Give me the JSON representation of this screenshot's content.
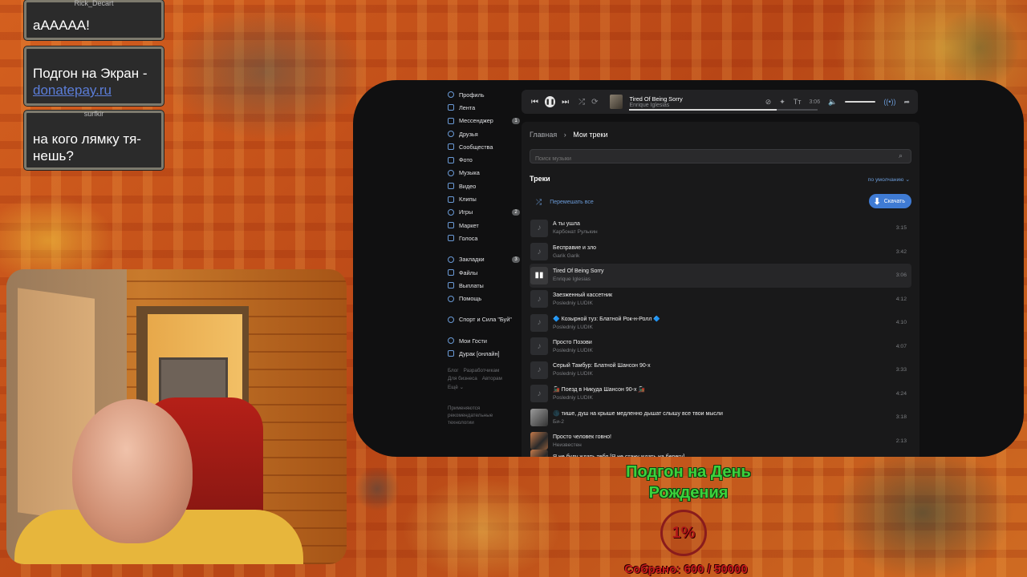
{
  "chat": [
    {
      "nick": "Rick_Decart",
      "text": "аААААА!"
    },
    {
      "nick": "",
      "text": "Подгон на Экран - ",
      "link": "donatepay.ru"
    },
    {
      "nick": "surfkir",
      "text": "на кого лямку тя-нешь?"
    }
  ],
  "sidebar": {
    "items": [
      {
        "label": "Профиль",
        "icon": "user-icon"
      },
      {
        "label": "Лента",
        "icon": "feed-icon"
      },
      {
        "label": "Мессенджер",
        "icon": "chat-icon",
        "badge": "1"
      },
      {
        "label": "Друзья",
        "icon": "friends-icon"
      },
      {
        "label": "Сообщества",
        "icon": "groups-icon"
      },
      {
        "label": "Фото",
        "icon": "photo-icon"
      },
      {
        "label": "Музыка",
        "icon": "music-icon"
      },
      {
        "label": "Видео",
        "icon": "video-icon"
      },
      {
        "label": "Клипы",
        "icon": "clips-icon"
      },
      {
        "label": "Игры",
        "icon": "games-icon",
        "badge": "2"
      },
      {
        "label": "Маркет",
        "icon": "market-icon"
      },
      {
        "label": "Голоса",
        "icon": "votes-icon"
      }
    ],
    "items2": [
      {
        "label": "Закладки",
        "icon": "bookmark-icon",
        "badge": "3"
      },
      {
        "label": "Файлы",
        "icon": "files-icon"
      },
      {
        "label": "Выплаты",
        "icon": "payments-icon"
      },
      {
        "label": "Помощь",
        "icon": "help-icon"
      }
    ],
    "items3": [
      {
        "label": "Спорт и Сила \"Буй\"",
        "icon": "community-icon"
      }
    ],
    "items4": [
      {
        "label": "Мои Гости",
        "icon": "guests-icon"
      },
      {
        "label": "Дурак [онлайн]",
        "icon": "app-icon"
      }
    ],
    "footer_links": [
      "Блог",
      "Разработчикам",
      "Для бизнеса",
      "Авторам",
      "Ещё ⌄"
    ],
    "footer_note": "Применяются рекомендательные технологии"
  },
  "player": {
    "title": "Tired Of Being Sorry",
    "artist": "Enrique Iglesias",
    "time": "3:06",
    "progress": 0.78
  },
  "content": {
    "breadcrumb_home": "Главная",
    "breadcrumb_sep": "›",
    "breadcrumb_current": "Мои треки",
    "search_placeholder": "Поиск музыки",
    "section_title": "Треки",
    "sort_label": "по умолчанию ⌄",
    "shuffle_label": "Перемешать все",
    "download_label": "Скачать",
    "tracks": [
      {
        "title": "А ты ушла",
        "artist": "Карбонат Рулькин",
        "duration": "3:15"
      },
      {
        "title": "Бесправие и зло",
        "artist": "Garik Garik",
        "duration": "3:42"
      },
      {
        "title": "Tired Of Being Sorry",
        "artist": "Enrique Iglesias",
        "duration": "3:06",
        "active": true
      },
      {
        "title": "Заезженный кассетник",
        "artist": "Posledniy LUDIK",
        "duration": "4:12"
      },
      {
        "title": "🔷 Козырной туз: Блатной Рок-н-Ролл 🔷",
        "artist": "Posledniy LUDIK",
        "duration": "4:10"
      },
      {
        "title": "Просто Позови",
        "artist": "Posledniy LUDIK",
        "duration": "4:07"
      },
      {
        "title": "Серый Тамбур: Блатной Шансон 90-х",
        "artist": "Posledniy LUDIK",
        "duration": "3:33"
      },
      {
        "title": "🚂 Поезд в Никуда Шансон 90-х 🚂",
        "artist": "Posledniy LUDIK",
        "duration": "4:24"
      },
      {
        "title": "🌑 тише, душ на крыше медленно дышат слышу все твои мысли",
        "artist": "Би-2",
        "duration": "3:18"
      },
      {
        "title": "Просто человек говно!",
        "artist": "Неизвестен",
        "duration": "2:13"
      },
      {
        "title": "Я не буду ждать тебя [Я не стану ждать на берегу]",
        "artist": "",
        "duration": ""
      }
    ]
  },
  "goal": {
    "title": "Подгон на День Рождения",
    "percent": "1%",
    "collected": "Собрано: 600 / 50000"
  },
  "colors": {
    "accent": "#6a9ad6",
    "download": "#3f7bd4",
    "goal_green": "#3cd23c",
    "goal_red": "#c81c1c"
  }
}
